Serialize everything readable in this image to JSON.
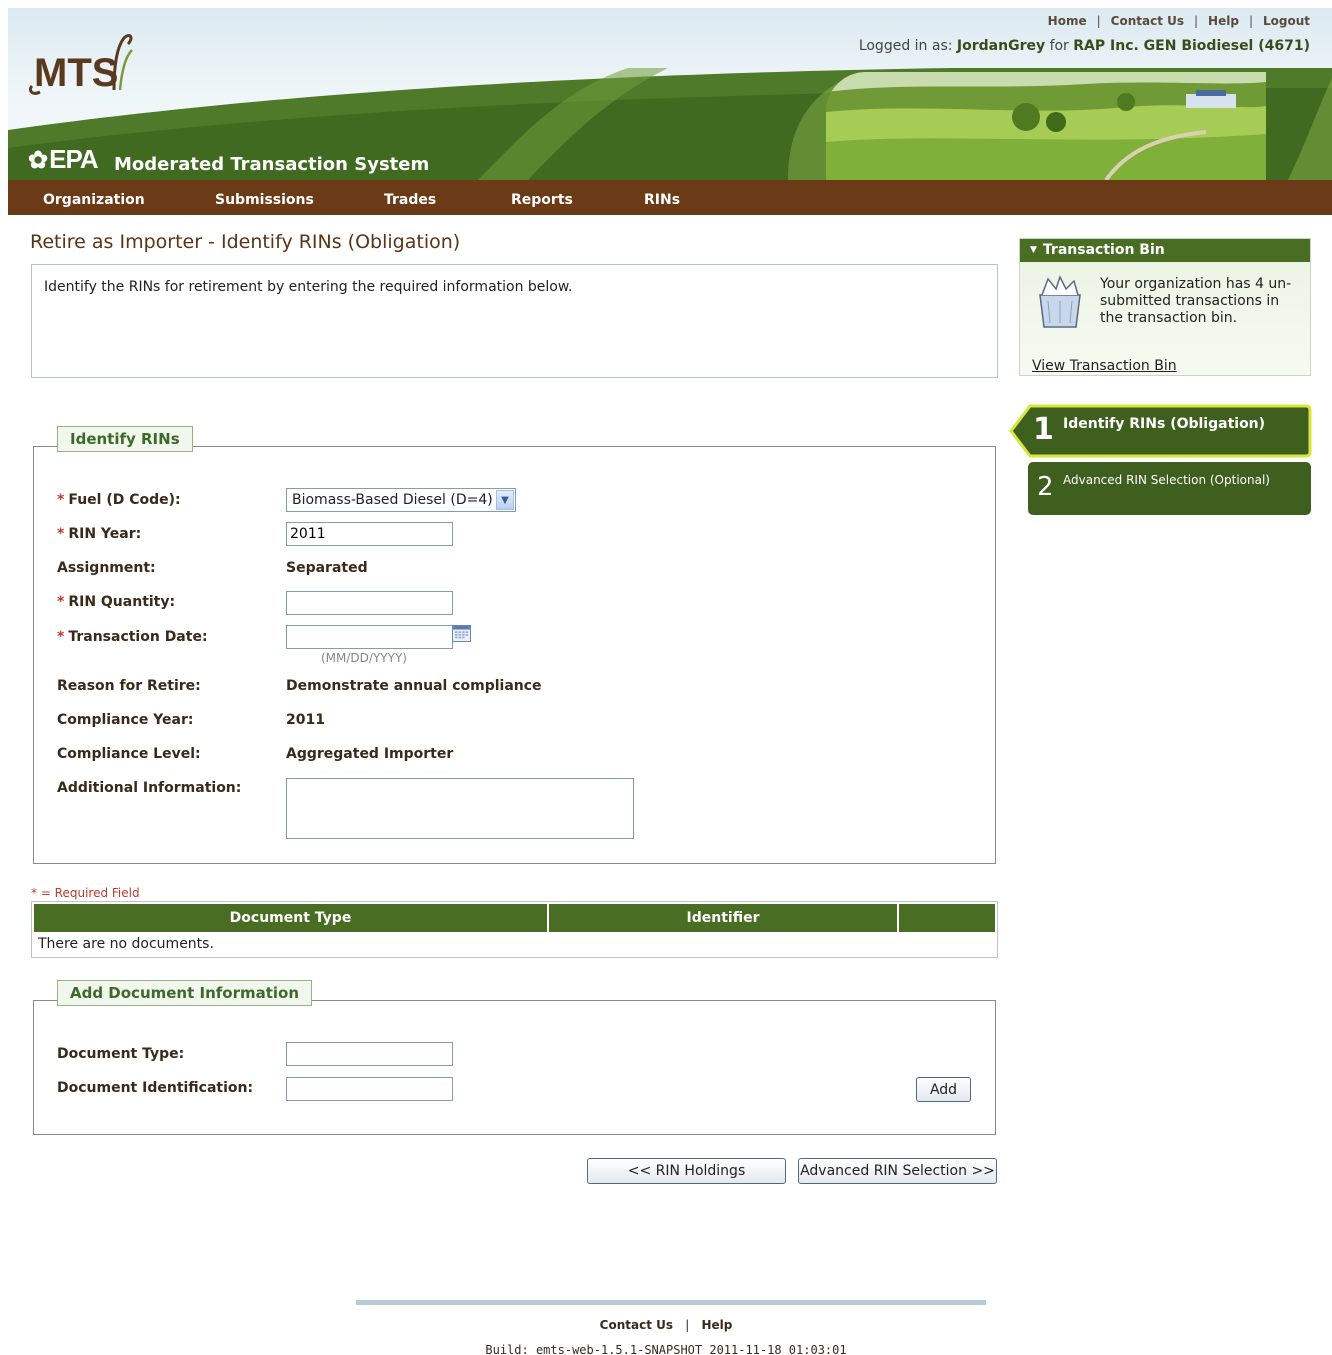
{
  "header": {
    "top_links": [
      "Home",
      "Contact Us",
      "Help",
      "Logout"
    ],
    "logged_in_prefix": "Logged in as:",
    "user": "JordanGrey",
    "for_word": "for",
    "organization": "RAP Inc. GEN Biodiesel (4671)",
    "mts_logo_text": "MTS",
    "epa_text": "EPA",
    "system_title": "Moderated Transaction System"
  },
  "nav": {
    "items": [
      "Organization",
      "Submissions",
      "Trades",
      "Reports",
      "RINs"
    ]
  },
  "main": {
    "title": "Retire as Importer - Identify RINs (Obligation)",
    "intro": "Identify the RINs for retirement by entering the required information below.",
    "identify_rins": {
      "legend": "Identify RINs",
      "fuel_label": "Fuel (D Code):",
      "fuel_value": "Biomass-Based Diesel (D=4)",
      "rin_year_label": "RIN Year:",
      "rin_year_value": "2011",
      "assignment_label": "Assignment:",
      "assignment_value": "Separated",
      "rin_quantity_label": "RIN Quantity:",
      "rin_quantity_value": "",
      "transaction_date_label": "Transaction Date:",
      "transaction_date_value": "",
      "date_format_hint": "(MM/DD/YYYY)",
      "reason_label": "Reason for Retire:",
      "reason_value": "Demonstrate annual compliance",
      "compliance_year_label": "Compliance Year:",
      "compliance_year_value": "2011",
      "compliance_level_label": "Compliance Level:",
      "compliance_level_value": "Aggregated Importer",
      "additional_info_label": "Additional Information:",
      "additional_info_value": "",
      "required_marker": "*"
    },
    "required_note": "* = Required Field",
    "documents": {
      "columns": [
        "Document Type",
        "Identifier",
        ""
      ],
      "empty_text": "There are no documents."
    },
    "add_document": {
      "legend": "Add Document Information",
      "doc_type_label": "Document Type:",
      "doc_type_value": "",
      "doc_id_label": "Document Identification:",
      "doc_id_value": "",
      "add_button": "Add"
    },
    "buttons": {
      "back": "<< RIN Holdings",
      "next": "Advanced RIN Selection >>"
    }
  },
  "sidebar": {
    "bin_title": "Transaction Bin",
    "bin_arrow": "▼",
    "bin_message": "Your organization has 4 un-submitted transactions in the transaction bin.",
    "bin_link": "View Transaction Bin",
    "steps": [
      {
        "number": "1",
        "label": "Identify RINs (Obligation)",
        "active": true
      },
      {
        "number": "2",
        "label": "Advanced RIN Selection (Optional)",
        "active": false
      }
    ]
  },
  "footer": {
    "links": [
      "Contact Us",
      "Help"
    ],
    "build": "Build: emts-web-1.5.1-SNAPSHOT 2011-11-18 01:03:01"
  },
  "colors": {
    "nav_bg": "#6b3a17",
    "header_green": "#4a6d24",
    "title_brown": "#5a3415",
    "required_red": "#c0392b"
  },
  "icons": [
    "calendar-icon",
    "transaction-bin-icon",
    "dropdown-arrow-icon",
    "epa-flower-icon"
  ]
}
